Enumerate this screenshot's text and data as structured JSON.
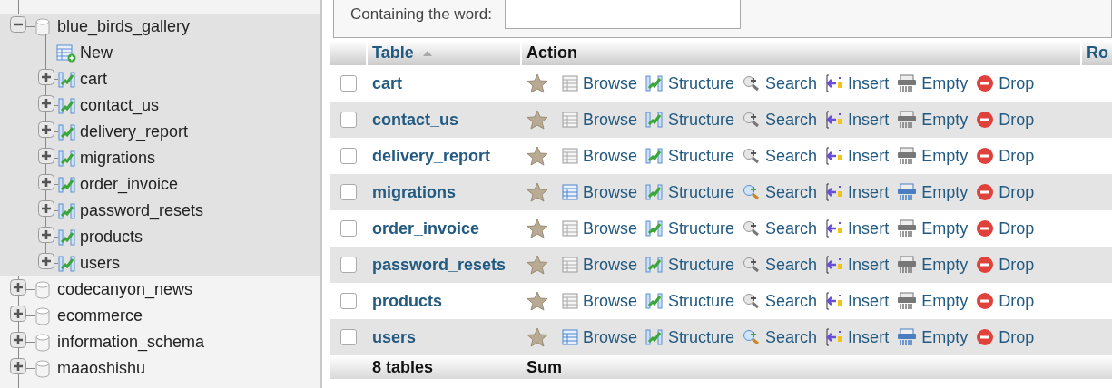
{
  "navigation": {
    "databases": [
      {
        "name": "blue_birds_gallery",
        "expanded": true,
        "children": [
          {
            "kind": "new",
            "name": "New"
          },
          {
            "kind": "table",
            "name": "cart"
          },
          {
            "kind": "table",
            "name": "contact_us"
          },
          {
            "kind": "table",
            "name": "delivery_report"
          },
          {
            "kind": "table",
            "name": "migrations"
          },
          {
            "kind": "table",
            "name": "order_invoice"
          },
          {
            "kind": "table",
            "name": "password_resets"
          },
          {
            "kind": "table",
            "name": "products"
          },
          {
            "kind": "table",
            "name": "users"
          }
        ]
      },
      {
        "name": "codecanyon_news",
        "expanded": false
      },
      {
        "name": "ecommerce",
        "expanded": false
      },
      {
        "name": "information_schema",
        "expanded": false
      },
      {
        "name": "maaoshishu",
        "expanded": false
      }
    ]
  },
  "filter": {
    "label": "Containing the word:"
  },
  "table": {
    "columns": [
      "Table",
      "Action",
      "Ro"
    ],
    "rows": [
      {
        "name": "cart",
        "checked": false,
        "populated": false,
        "actions": [
          {
            "kind": "browse",
            "label": "Browse"
          },
          {
            "kind": "structure",
            "label": "Structure"
          },
          {
            "kind": "search",
            "label": "Search"
          },
          {
            "kind": "insert",
            "label": "Insert"
          },
          {
            "kind": "empty",
            "label": "Empty"
          },
          {
            "kind": "drop",
            "label": "Drop"
          }
        ]
      },
      {
        "name": "contact_us",
        "checked": false,
        "populated": false,
        "actions": [
          {
            "kind": "browse",
            "label": "Browse"
          },
          {
            "kind": "structure",
            "label": "Structure"
          },
          {
            "kind": "search",
            "label": "Search"
          },
          {
            "kind": "insert",
            "label": "Insert"
          },
          {
            "kind": "empty",
            "label": "Empty"
          },
          {
            "kind": "drop",
            "label": "Drop"
          }
        ]
      },
      {
        "name": "delivery_report",
        "checked": false,
        "populated": false,
        "actions": [
          {
            "kind": "browse",
            "label": "Browse"
          },
          {
            "kind": "structure",
            "label": "Structure"
          },
          {
            "kind": "search",
            "label": "Search"
          },
          {
            "kind": "insert",
            "label": "Insert"
          },
          {
            "kind": "empty",
            "label": "Empty"
          },
          {
            "kind": "drop",
            "label": "Drop"
          }
        ]
      },
      {
        "name": "migrations",
        "checked": false,
        "populated": true,
        "actions": [
          {
            "kind": "browse",
            "label": "Browse"
          },
          {
            "kind": "structure",
            "label": "Structure"
          },
          {
            "kind": "search",
            "label": "Search"
          },
          {
            "kind": "insert",
            "label": "Insert"
          },
          {
            "kind": "empty",
            "label": "Empty"
          },
          {
            "kind": "drop",
            "label": "Drop"
          }
        ]
      },
      {
        "name": "order_invoice",
        "checked": false,
        "populated": false,
        "actions": [
          {
            "kind": "browse",
            "label": "Browse"
          },
          {
            "kind": "structure",
            "label": "Structure"
          },
          {
            "kind": "search",
            "label": "Search"
          },
          {
            "kind": "insert",
            "label": "Insert"
          },
          {
            "kind": "empty",
            "label": "Empty"
          },
          {
            "kind": "drop",
            "label": "Drop"
          }
        ]
      },
      {
        "name": "password_resets",
        "checked": false,
        "populated": false,
        "actions": [
          {
            "kind": "browse",
            "label": "Browse"
          },
          {
            "kind": "structure",
            "label": "Structure"
          },
          {
            "kind": "search",
            "label": "Search"
          },
          {
            "kind": "insert",
            "label": "Insert"
          },
          {
            "kind": "empty",
            "label": "Empty"
          },
          {
            "kind": "drop",
            "label": "Drop"
          }
        ]
      },
      {
        "name": "products",
        "checked": false,
        "populated": false,
        "actions": [
          {
            "kind": "browse",
            "label": "Browse"
          },
          {
            "kind": "structure",
            "label": "Structure"
          },
          {
            "kind": "search",
            "label": "Search"
          },
          {
            "kind": "insert",
            "label": "Insert"
          },
          {
            "kind": "empty",
            "label": "Empty"
          },
          {
            "kind": "drop",
            "label": "Drop"
          }
        ]
      },
      {
        "name": "users",
        "checked": false,
        "populated": true,
        "actions": [
          {
            "kind": "browse",
            "label": "Browse"
          },
          {
            "kind": "structure",
            "label": "Structure"
          },
          {
            "kind": "search",
            "label": "Search"
          },
          {
            "kind": "insert",
            "label": "Insert"
          },
          {
            "kind": "empty",
            "label": "Empty"
          },
          {
            "kind": "drop",
            "label": "Drop"
          }
        ]
      }
    ],
    "footer": [
      "8 tables",
      "Sum"
    ]
  }
}
